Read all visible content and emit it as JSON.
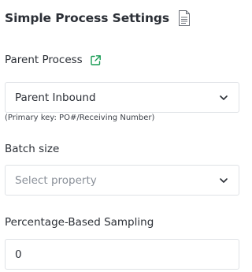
{
  "header": {
    "title": "Simple Process Settings",
    "icon": "document-icon"
  },
  "parent_process": {
    "label": "Parent Process",
    "link_icon": "external-link-icon",
    "link_icon_color": "#1a9c55",
    "selected_value": "Parent Inbound",
    "hint": "(Primary key: PO#/Receiving Number)"
  },
  "batch_size": {
    "label": "Batch size",
    "placeholder": "Select property"
  },
  "sampling": {
    "label": "Percentage-Based Sampling",
    "value": "0"
  }
}
